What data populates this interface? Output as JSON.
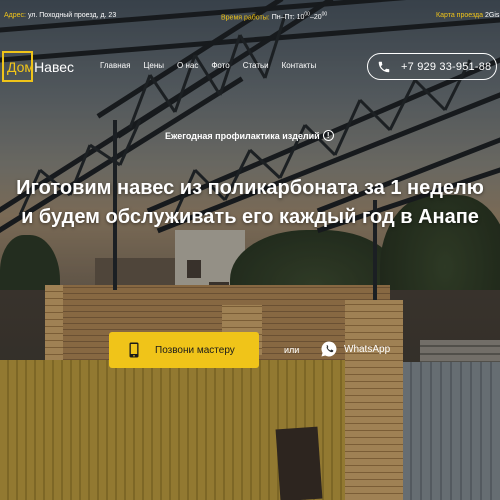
{
  "topbar": {
    "address_label": "Адрес:",
    "address_value": "ул. Походный проезд, д. 23",
    "hours_label": "Время работы:",
    "hours_value": "Пн–Пт: 10",
    "hours_open_sup": "00",
    "hours_sep": "–20",
    "hours_close_sup": "00",
    "map_label": "Карта проезда",
    "map_value": "2Gis"
  },
  "header": {
    "logo_part1": "Дом",
    "logo_part2": "Навес",
    "nav": [
      "Главная",
      "Цены",
      "О нас",
      "Фото",
      "Статьи",
      "Контакты"
    ],
    "phone": "+7 929 33-951-88"
  },
  "hero": {
    "notice": "Ежегодная профилактика изделий",
    "info_icon_glyph": "!",
    "headline": "Иготовим навес из поликарбоната за 1 неделю и будем обслуживать его каждый год в Анапе",
    "cta_label": "Позвони мастеру",
    "or_text": "или",
    "whatsapp_label": "WhatsApp"
  },
  "colors": {
    "accent": "#f0c419",
    "text": "#ffffff",
    "whatsapp": "#ffffff"
  },
  "icons": {
    "phone": "phone-handset-icon",
    "mobile": "mobile-phone-icon",
    "whatsapp": "whatsapp-icon",
    "info": "info-circle-icon"
  }
}
